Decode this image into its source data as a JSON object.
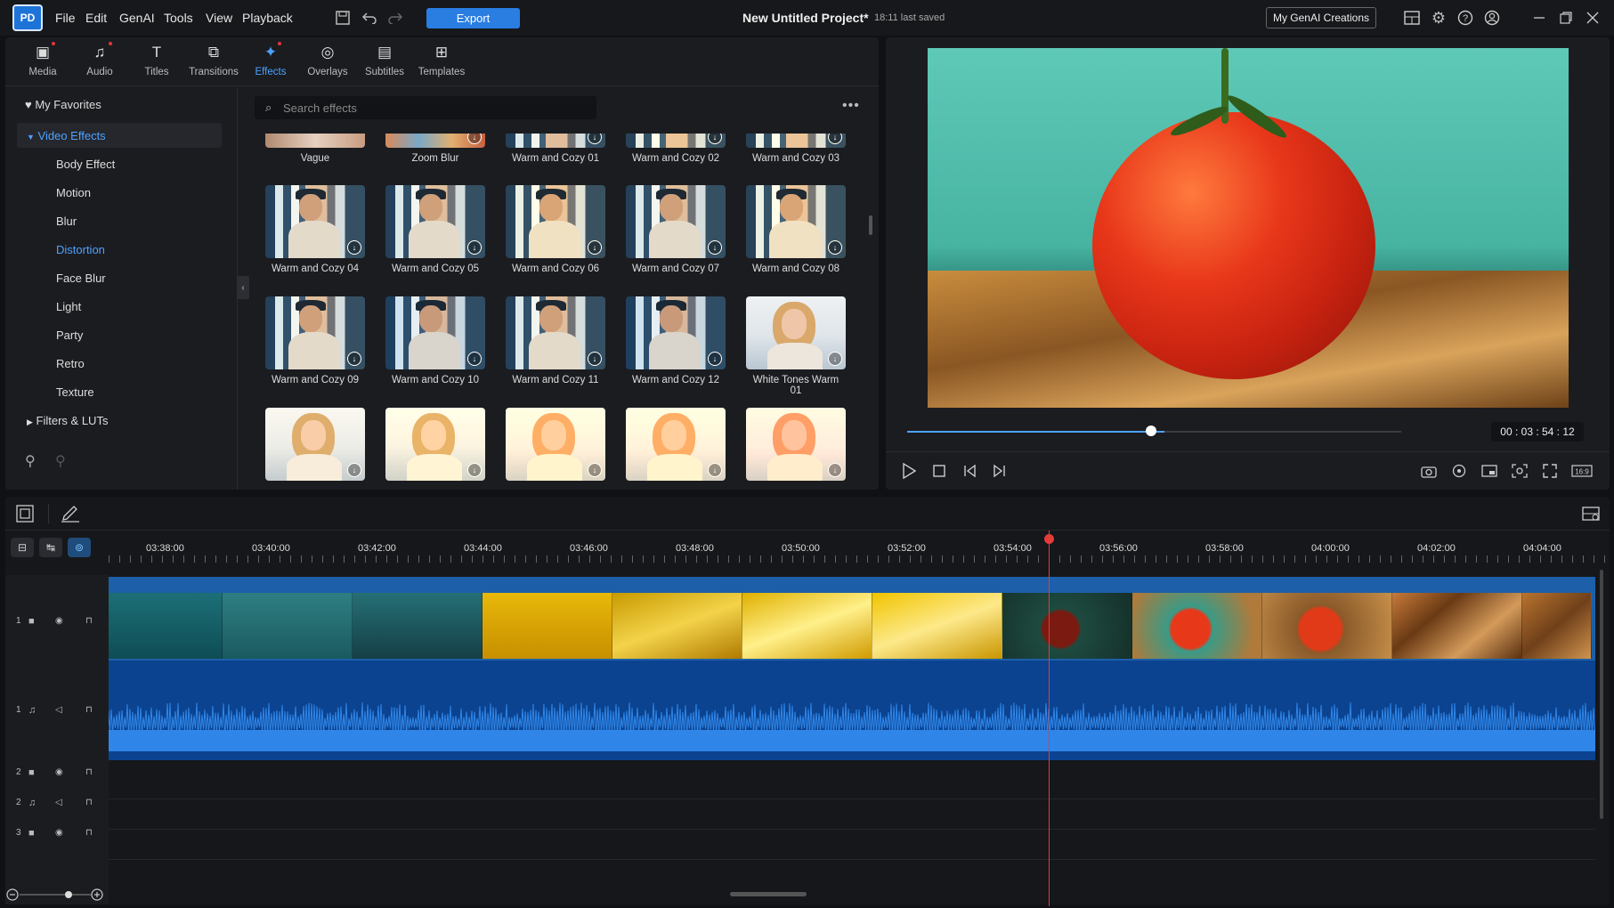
{
  "menubar": {
    "logo": "PD",
    "menus": [
      "File",
      "Edit",
      "GenAI",
      "Tools",
      "View",
      "Playback"
    ],
    "export_label": "Export",
    "project_title": "New Untitled Project*",
    "saved_text": "18:11 last saved",
    "genai_creations": "My GenAI Creations"
  },
  "library_tabs": [
    {
      "label": "Media",
      "icon": "media-icon",
      "dot": true
    },
    {
      "label": "Audio",
      "icon": "audio-icon",
      "dot": true
    },
    {
      "label": "Titles",
      "icon": "titles-icon",
      "dot": false
    },
    {
      "label": "Transitions",
      "icon": "transitions-icon",
      "dot": false
    },
    {
      "label": "Effects",
      "icon": "effects-icon",
      "dot": true,
      "active": true
    },
    {
      "label": "Overlays",
      "icon": "overlays-icon",
      "dot": false
    },
    {
      "label": "Subtitles",
      "icon": "subtitles-icon",
      "dot": false
    },
    {
      "label": "Templates",
      "icon": "templates-icon",
      "dot": false
    }
  ],
  "sidebar": {
    "favorites": "My Favorites",
    "video_effects": "Video Effects",
    "items": [
      "Body Effect",
      "Motion",
      "Blur",
      "Distortion",
      "Face Blur",
      "Light",
      "Party",
      "Retro",
      "Texture"
    ],
    "filters": "Filters & LUTs",
    "selected": "Distortion"
  },
  "search": {
    "placeholder": "Search effects"
  },
  "effects": {
    "row0": [
      "Vague",
      "Zoom Blur",
      "Warm and Cozy 01",
      "Warm and Cozy 02",
      "Warm and Cozy 03"
    ],
    "row1": [
      "Warm and Cozy 04",
      "Warm and Cozy 05",
      "Warm and Cozy 06",
      "Warm and Cozy 07",
      "Warm and Cozy 08"
    ],
    "row2": [
      "Warm and Cozy 09",
      "Warm and Cozy 10",
      "Warm and Cozy 11",
      "Warm and Cozy 12",
      "White Tones Warm 01"
    ]
  },
  "preview": {
    "timecode": "00 : 03 : 54 : 12",
    "progress": 0.52,
    "aspect_ratio": "16:9"
  },
  "timeline": {
    "ticks": [
      "03:38:00",
      "03:40:00",
      "03:42:00",
      "03:44:00",
      "03:46:00",
      "03:48:00",
      "03:50:00",
      "03:52:00",
      "03:54:00",
      "03:56:00",
      "03:58:00",
      "04:00:00",
      "04:02:00",
      "04:04:00"
    ],
    "tracks": [
      {
        "num": "1",
        "type": "video"
      },
      {
        "num": "1",
        "type": "audio"
      },
      {
        "num": "2",
        "type": "video"
      },
      {
        "num": "2",
        "type": "audio"
      },
      {
        "num": "3",
        "type": "video"
      }
    ]
  },
  "colors": {
    "accent": "#2a7de1",
    "playhead": "#e43b3b",
    "video_track": "#1d5fa8",
    "audio_track": "#0b4390"
  }
}
